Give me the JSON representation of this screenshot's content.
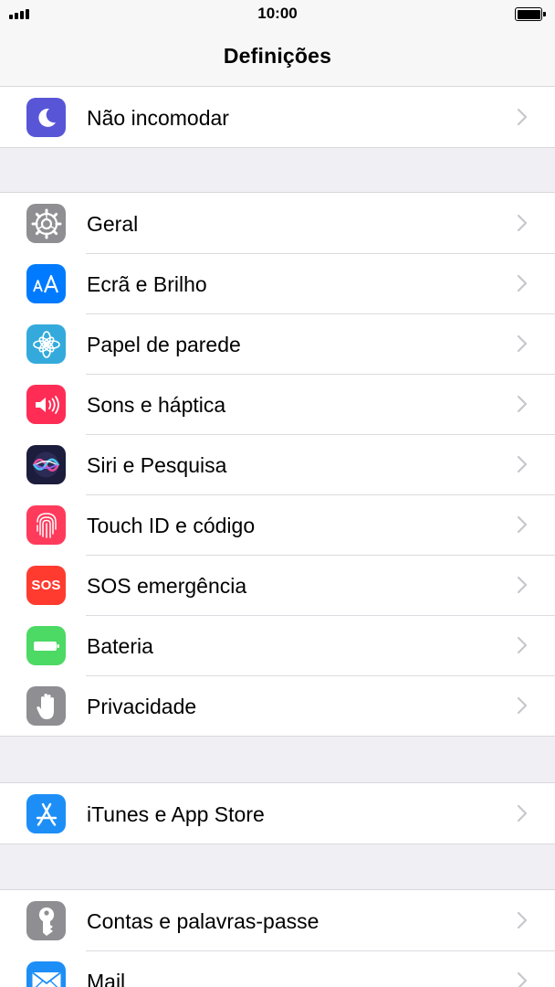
{
  "status_bar": {
    "time": "10:00",
    "signal_bars": 4,
    "battery_level": 1.0
  },
  "nav": {
    "title": "Definições"
  },
  "groups": [
    {
      "items": [
        {
          "label": "Não incomodar",
          "icon": "moon-icon",
          "color": "#5856d6"
        }
      ]
    },
    {
      "items": [
        {
          "label": "Geral",
          "icon": "gear-icon",
          "color": "#8e8e93"
        },
        {
          "label": "Ecrã e Brilho",
          "icon": "display-brightness-icon",
          "color": "#007aff"
        },
        {
          "label": "Papel de parede",
          "icon": "flower-icon",
          "color": "#34aadc"
        },
        {
          "label": "Sons e háptica",
          "icon": "speaker-icon",
          "color": "#ff2d55"
        },
        {
          "label": "Siri e Pesquisa",
          "icon": "siri-icon",
          "color": "#1c1c3c"
        },
        {
          "label": "Touch ID e código",
          "icon": "fingerprint-icon",
          "color": "#ff3b5c"
        },
        {
          "label": "SOS emergência",
          "icon": "sos-icon",
          "color": "#ff3b30",
          "icon_text": "SOS"
        },
        {
          "label": "Bateria",
          "icon": "battery-icon",
          "color": "#4cd964"
        },
        {
          "label": "Privacidade",
          "icon": "hand-icon",
          "color": "#8e8e93"
        }
      ]
    },
    {
      "items": [
        {
          "label": "iTunes e App Store",
          "icon": "app-store-icon",
          "color": "#1e8ef7"
        }
      ]
    },
    {
      "items": [
        {
          "label": "Contas e palavras-passe",
          "icon": "key-icon",
          "color": "#8e8e93"
        },
        {
          "label": "Mail",
          "icon": "mail-icon",
          "color": "#1e8ef7"
        }
      ]
    }
  ]
}
